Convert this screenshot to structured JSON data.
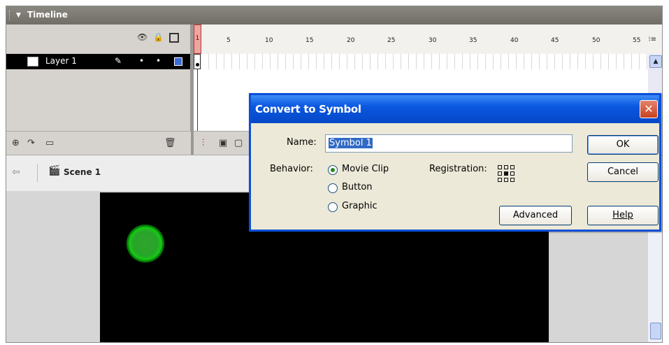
{
  "timeline": {
    "title": "Timeline",
    "header_icons": [
      "eye-icon",
      "lock-icon",
      "outline-icon"
    ],
    "ruler_ticks": [
      "1",
      "5",
      "10",
      "15",
      "20",
      "25",
      "30",
      "35",
      "40",
      "45",
      "50",
      "55"
    ],
    "layer": {
      "name": "Layer 1",
      "color": "#3a6bd6"
    },
    "layer_tools": [
      "insert-layer-icon",
      "add-motion-guide-icon",
      "insert-layer-folder-icon",
      "delete-layer-icon"
    ]
  },
  "scene": {
    "label": "Scene 1"
  },
  "stage": {
    "background": "#000000",
    "symbol_color": "#2cd42c"
  },
  "dialog": {
    "title": "Convert to Symbol",
    "name_label": "Name:",
    "name_value": "Symbol 1",
    "behavior_label": "Behavior:",
    "behavior_options": [
      "Movie Clip",
      "Button",
      "Graphic"
    ],
    "behavior_selected": "Movie Clip",
    "registration_label": "Registration:",
    "buttons": {
      "ok": "OK",
      "cancel": "Cancel",
      "advanced": "Advanced",
      "help": "Help"
    }
  }
}
